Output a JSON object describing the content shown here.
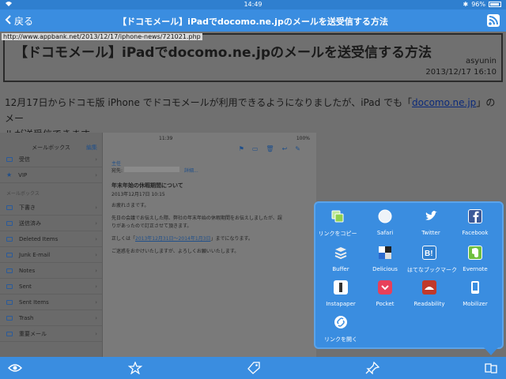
{
  "status": {
    "time": "14:49",
    "battery": "96%"
  },
  "nav": {
    "back_label": "戻る",
    "title": "【ドコモメール】iPadでdocomo.ne.jpのメールを送受信する方法",
    "rss_icon": "rss-icon"
  },
  "article": {
    "url": "http://www.appbank.net/2013/12/17/iphone-news/721021.php",
    "title": "【ドコモメール】iPadでdocomo.ne.jpのメールを送受信する方法",
    "author": "asyunin",
    "date": "2013/12/17 16:10",
    "body_line1": "12月17日からドコモ版 iPhone でドコモメールが利用できるようになりましたが、iPad でも「",
    "body_link": "docomo.ne.jp",
    "body_line1_end": "」のメー",
    "body_line2": "ルが送受信できます。"
  },
  "embedded": {
    "sidebar_title": "メールボックス",
    "edit": "編集",
    "section_label": "メールボックス",
    "top_items": [
      "受信",
      "VIP"
    ],
    "items": [
      "下書き",
      "送信済み",
      "Deleted Items",
      "Junk E-mail",
      "Notes",
      "Sent",
      "Sent Items",
      "Trash",
      "重要メール"
    ],
    "time": "11:39",
    "battery": "100%",
    "from": "主任",
    "to": "宛先:",
    "detail": "詳細...",
    "subject": "年末年始の休暇期間について",
    "mail_date": "2013年12月17日 10:15",
    "line1": "お疲れさまです。",
    "line2": "先日の会議でお伝えした際、弊社の年末年始の休暇期間をお伝えしましたが、誤",
    "line3": "りがあったので訂正させて頂きます。",
    "line4_pre": "正しくは「",
    "line4_link": "2013年12月31日〜2014年1月3日",
    "line4_post": "」までになります。",
    "line5": "ご迷惑をおかけいたしますが、よろしくお願いいたします。"
  },
  "share": {
    "items": [
      {
        "label": "リンクをコピー",
        "icon": "copy-link-icon",
        "color": "#8fd14f"
      },
      {
        "label": "Safari",
        "icon": "safari-icon",
        "color": "#e8eef5"
      },
      {
        "label": "Twitter",
        "icon": "twitter-icon",
        "color": "#3a8de0"
      },
      {
        "label": "Facebook",
        "icon": "facebook-icon",
        "color": "#3b5998"
      },
      {
        "label": "Buffer",
        "icon": "buffer-icon",
        "color": "#5a5a5a"
      },
      {
        "label": "Delicious",
        "icon": "delicious-icon",
        "color": "#ffffff"
      },
      {
        "label": "はてなブックマーク",
        "icon": "hatena-bookmark-icon",
        "color": "#2f7fcf"
      },
      {
        "label": "Evernote",
        "icon": "evernote-icon",
        "color": "#6fbf3f"
      },
      {
        "label": "Instapaper",
        "icon": "instapaper-icon",
        "color": "#ffffff"
      },
      {
        "label": "Pocket",
        "icon": "pocket-icon",
        "color": "#e8405a"
      },
      {
        "label": "Readability",
        "icon": "readability-icon",
        "color": "#c0392b"
      },
      {
        "label": "Mobilizer",
        "icon": "mobilizer-icon",
        "color": "#ffffff"
      },
      {
        "label": "リンクを開く",
        "icon": "open-link-icon",
        "color": "#ffffff"
      }
    ]
  },
  "toolbar": {
    "icons": [
      "eye-icon",
      "star-icon",
      "tag-icon",
      "pin-icon",
      "share-icon"
    ]
  }
}
